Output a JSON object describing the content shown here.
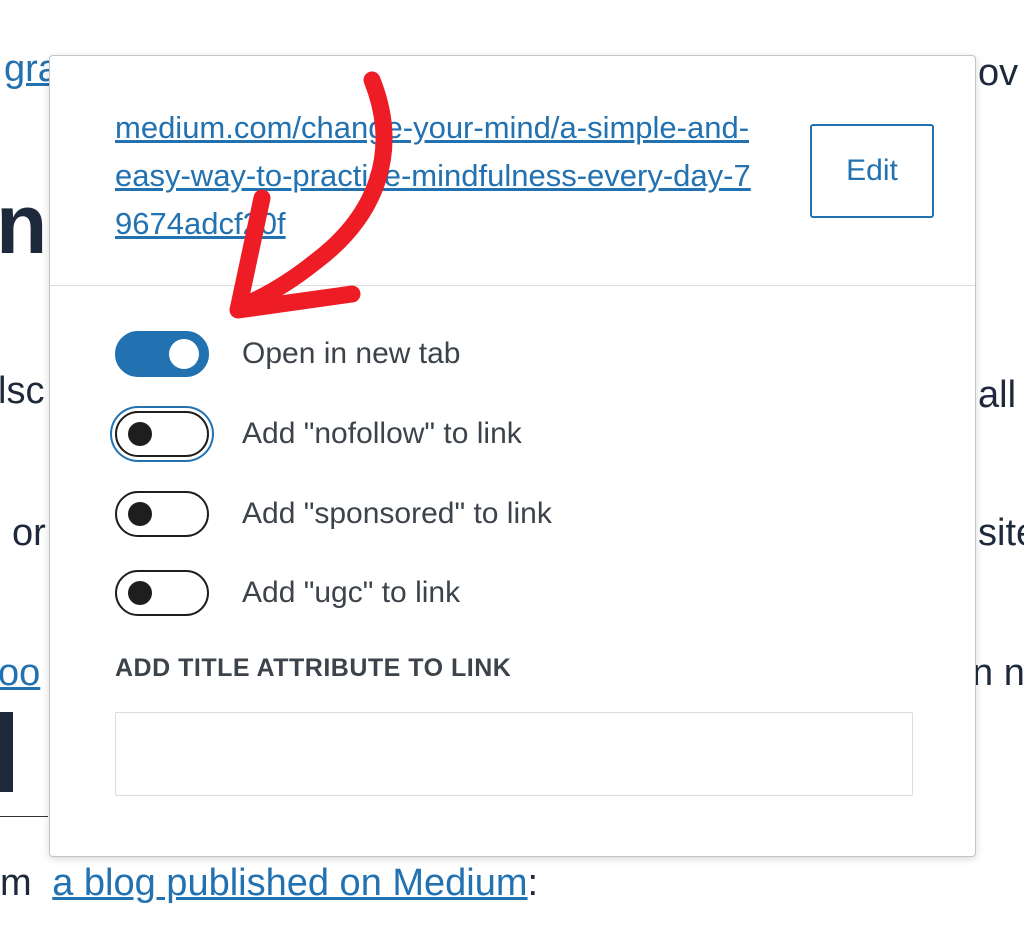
{
  "background": {
    "frag_top_left": "gra",
    "frag_top_right": "ov",
    "frag_big": "n",
    "frag_mid_left": "lsc",
    "frag_mid_right": "all",
    "frag_row3_left": "or",
    "frag_row3_right": "site",
    "frag_row4_left": "oo",
    "frag_row4_right": "n n",
    "bottom_prefix": "m",
    "bottom_link": "a blog published on Medium",
    "bottom_suffix": ":"
  },
  "popover": {
    "url": "medium.com/change-your-mind/a-simple-and-easy-way-to-practice-mindfulness-every-day-79674adcf20f",
    "edit_label": "Edit",
    "toggles": [
      {
        "label": "Open in new tab",
        "checked": true
      },
      {
        "label": "Add \"nofollow\" to link",
        "checked": false
      },
      {
        "label": "Add \"sponsored\" to link",
        "checked": false
      },
      {
        "label": "Add \"ugc\" to link",
        "checked": false
      }
    ],
    "title_field_label": "ADD TITLE ATTRIBUTE TO LINK",
    "title_field_value": ""
  },
  "colors": {
    "accent": "#2271b1",
    "annotation_arrow": "#ee1c25"
  },
  "icons": {
    "annotation": "red-curved-arrow-icon"
  }
}
